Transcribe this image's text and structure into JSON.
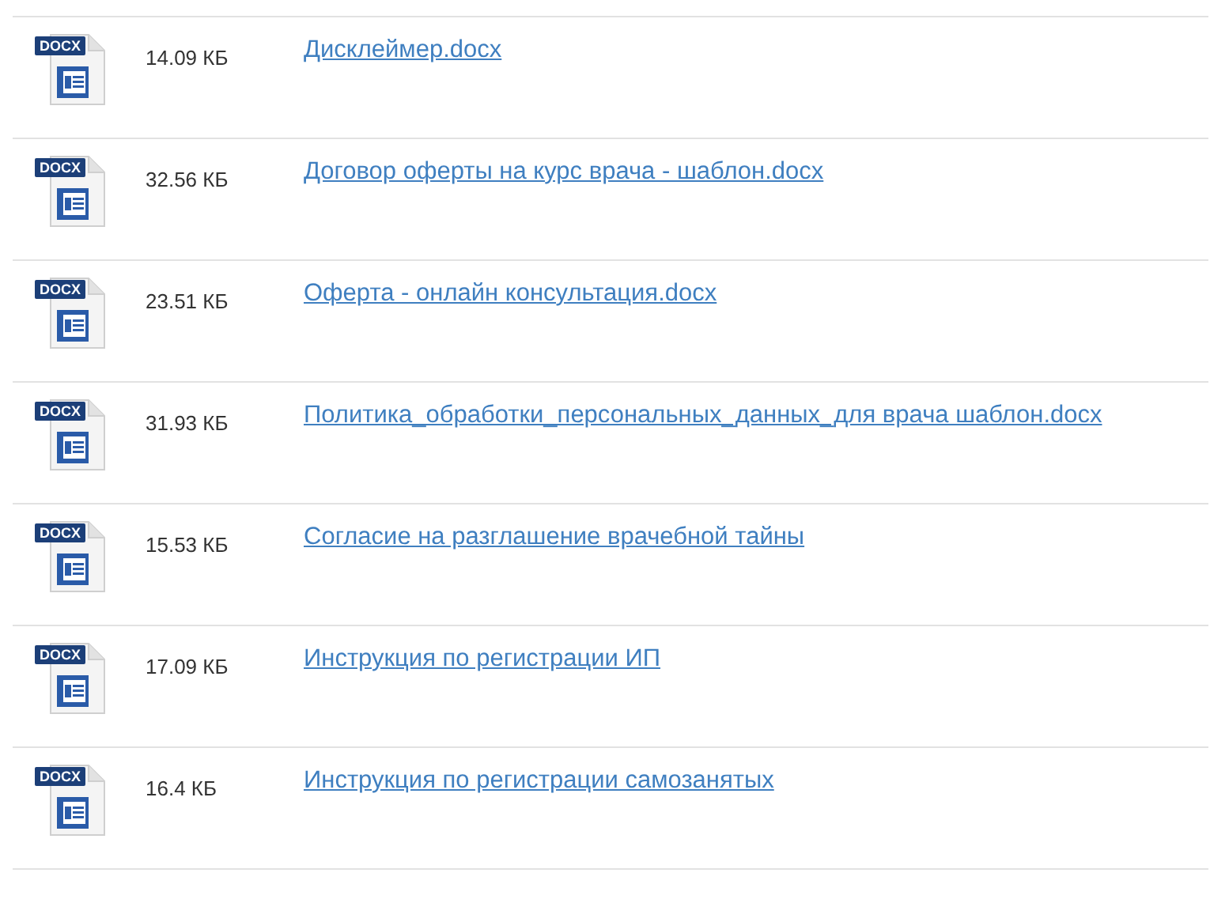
{
  "files": [
    {
      "badge": "DOCX",
      "size": "14.09 КБ",
      "name": "Дисклеймер.docx"
    },
    {
      "badge": "DOCX",
      "size": "32.56 КБ",
      "name": "Договор оферты на курс врача - шаблон.docx"
    },
    {
      "badge": "DOCX",
      "size": "23.51 КБ",
      "name": "Оферта - онлайн консультация.docx"
    },
    {
      "badge": "DOCX",
      "size": "31.93 КБ",
      "name": "Политика_обработки_персональных_данных_для врача шаблон.docx"
    },
    {
      "badge": "DOCX",
      "size": "15.53 КБ",
      "name": "Согласие на разглашение врачебной тайны"
    },
    {
      "badge": "DOCX",
      "size": "17.09 КБ",
      "name": "Инструкция по регистрации ИП"
    },
    {
      "badge": "DOCX",
      "size": "16.4 КБ",
      "name": "Инструкция по регистрации самозанятых"
    }
  ]
}
